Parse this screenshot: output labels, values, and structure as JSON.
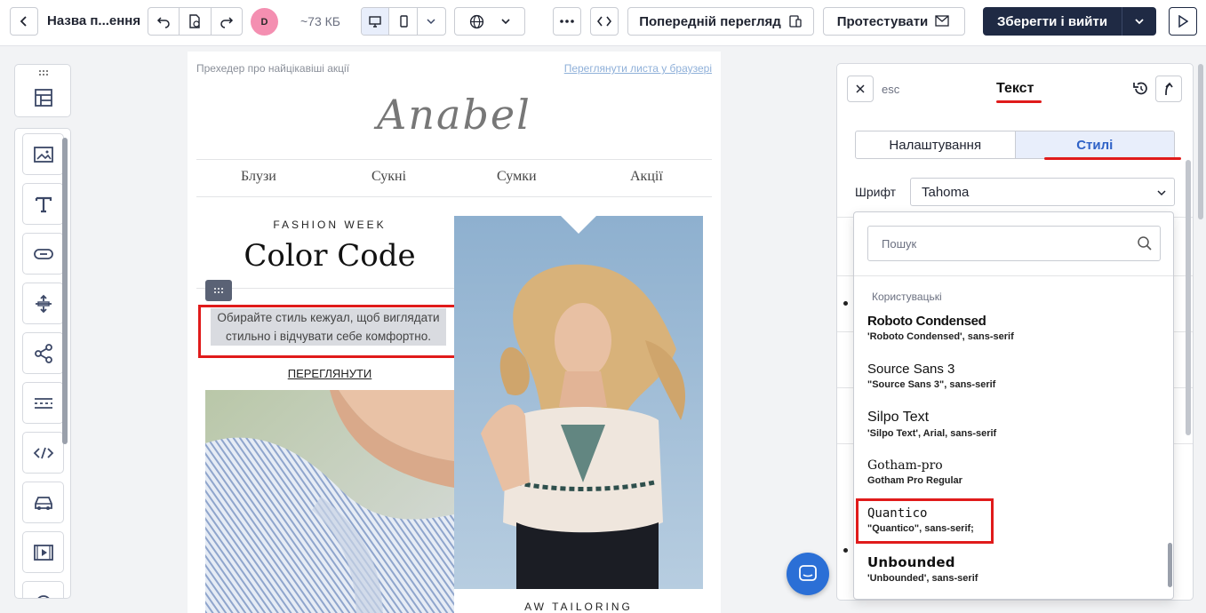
{
  "toolbar": {
    "title": "Назва п...ення",
    "avatar_initial": "D",
    "size": "~73 КБ",
    "preview_label": "Попередній перегляд",
    "test_label": "Протестувати",
    "save_label": "Зберегти і вийти"
  },
  "email": {
    "preheader": "Прехедер про найцікавіші акції",
    "browser_link": "Переглянути листа у браузері",
    "logo": "Anabel",
    "nav": [
      "Блузи",
      "Сукні",
      "Сумки",
      "Акції"
    ],
    "eyebrow": "FASHION WEEK",
    "headline": "Color Code",
    "selected_text": "Обирайте стиль кежуал, щоб виглядати стильно і відчувати себе комфортно.",
    "cta": "ПЕРЕГЛЯНУТИ",
    "second_eyebrow": "AW TAILORING"
  },
  "panel": {
    "esc": "esc",
    "title": "Текст",
    "tabs": [
      "Налаштування",
      "Стилі"
    ],
    "active_tab": "Стилі",
    "font_label": "Шрифт",
    "font_value": "Tahoma"
  },
  "dropdown": {
    "search_placeholder": "Пошук",
    "group_label": "Користувацькі",
    "fonts": [
      {
        "name": "Roboto Condensed",
        "css": "'Roboto Condensed', sans-serif"
      },
      {
        "name": "Source Sans 3",
        "css": "\"Source Sans 3\", sans-serif"
      },
      {
        "name": "Silpo Text",
        "css": "'Silpo Text', Arial, sans-serif"
      },
      {
        "name": "Gotham-pro",
        "css": "Gotham Pro Regular"
      },
      {
        "name": "Quantico",
        "css": "\"Quantico\", sans-serif;"
      },
      {
        "name": "Unbounded",
        "css": "'Unbounded', sans-serif"
      }
    ]
  },
  "colors": {
    "accent_blue": "#2f62c7",
    "highlight_red": "#e01b1b",
    "primary_dark": "#1f2a44"
  }
}
